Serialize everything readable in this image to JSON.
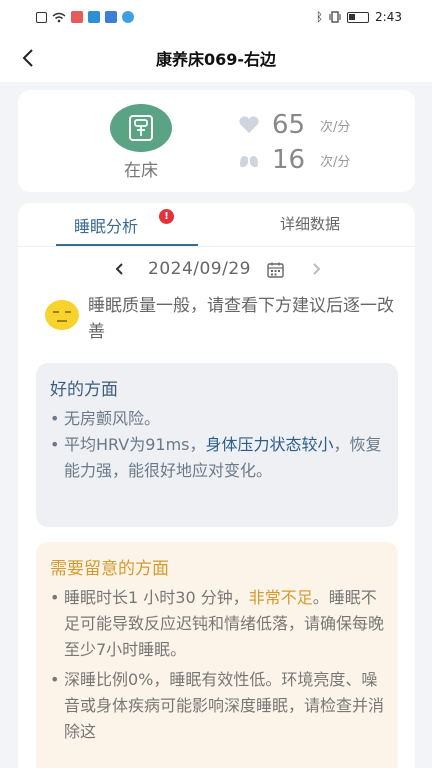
{
  "status_bar": {
    "time": "2:43"
  },
  "nav": {
    "title": "康养床069-右边"
  },
  "bed_card": {
    "status_label": "在床",
    "heart_rate": "65",
    "heart_rate_unit": "次/分",
    "breath_rate": "16",
    "breath_rate_unit": "次/分",
    "accent_color": "#5aa384"
  },
  "tabs": {
    "active": "睡眠分析",
    "active_badge": "!",
    "inactive": "详细数据"
  },
  "date_picker": {
    "date": "2024/09/29"
  },
  "summary": {
    "text": "睡眠质量一般，请查看下方建议后逐一改善"
  },
  "good": {
    "title": "好的方面",
    "item1": "无房颤风险。",
    "item2_part1": "平均HRV为91ms，",
    "item2_highlight": "身体压力状态较小",
    "item2_part2": "，恢复能力强，能很好地应对变化。"
  },
  "attention": {
    "title": "需要留意的方面",
    "item1_part1": "睡眠时长1 小时30 分钟，",
    "item1_highlight": "非常不足",
    "item1_part2": "。睡眠不足可能导致反应迟钝和情绪低落，请确保每晚至少7小时睡眠。",
    "item2": "深睡比例0%，睡眠有效性低。环境亮度、噪音或身体疾病可能影响深度睡眠，请检查并消除这"
  },
  "colors": {
    "tab_active": "#3a6c8f",
    "good_box_bg": "#eef0f4",
    "warn_box_bg": "#fdf4e9",
    "warn_title": "#d49a2f"
  }
}
